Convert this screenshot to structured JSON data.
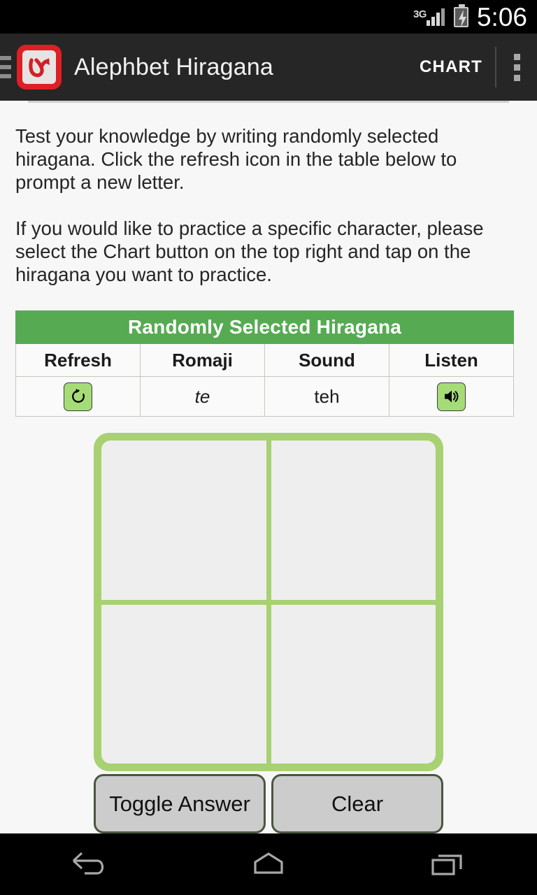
{
  "status_bar": {
    "network_label": "3G",
    "network_icon": "signal-bars-icon",
    "battery_icon": "battery-charging-icon",
    "time": "5:06"
  },
  "action_bar": {
    "menu_icon": "hamburger-menu-icon",
    "app_icon": "app-logo-hiragana-hi-icon",
    "app_icon_glyph": "ひ",
    "title": "Alephbet Hiragana",
    "chart_label": "CHART",
    "overflow_icon": "overflow-menu-icon"
  },
  "instructions": {
    "paragraph_1": "Test your knowledge by writing randomly selected hiragana.  Click the refresh icon in the table below to prompt a new letter.",
    "paragraph_2": "If you would like to practice a specific character, please select the Chart button on the top right and tap on the hiragana you want to practice."
  },
  "table": {
    "banner": "Randomly Selected Hiragana",
    "headers": [
      "Refresh",
      "Romaji",
      "Sound",
      "Listen"
    ],
    "row": {
      "refresh_icon": "refresh-icon",
      "romaji": "te",
      "sound": "teh",
      "listen_icon": "speaker-icon"
    }
  },
  "canvas": {
    "name": "drawing-canvas",
    "quadrants": [
      "top-left",
      "top-right",
      "bottom-left",
      "bottom-right"
    ]
  },
  "buttons": {
    "toggle_answer": "Toggle Answer",
    "clear": "Clear"
  },
  "nav_bar": {
    "back_icon": "back-icon",
    "home_icon": "home-icon",
    "recents_icon": "recents-icon"
  },
  "colors": {
    "accent_green": "#56ab52",
    "canvas_green": "#a7d172",
    "icon_green": "#a5dc77",
    "brand_red": "#de1f26",
    "action_bar": "#262626"
  }
}
